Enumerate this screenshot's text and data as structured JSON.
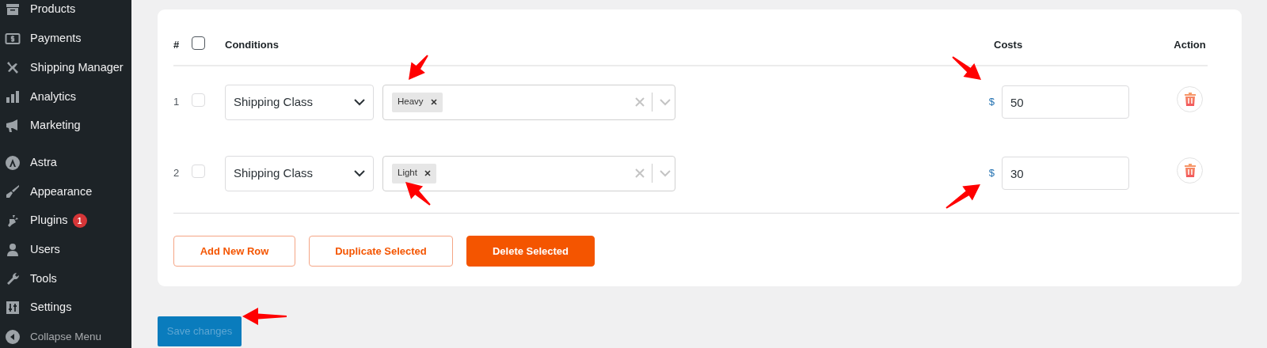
{
  "sidebar": {
    "groups": [
      [
        {
          "label": "Products"
        },
        {
          "label": "Payments"
        },
        {
          "label": "Shipping Manager"
        },
        {
          "label": "Analytics"
        },
        {
          "label": "Marketing"
        }
      ],
      [
        {
          "label": "Astra"
        },
        {
          "label": "Appearance"
        },
        {
          "label": "Plugins",
          "badge": "1"
        },
        {
          "label": "Users"
        },
        {
          "label": "Tools"
        },
        {
          "label": "Settings"
        }
      ]
    ],
    "collapse": {
      "label": "Collapse Menu"
    }
  },
  "table": {
    "columns": [
      {
        "label": "#",
        "kind": "number"
      },
      {
        "kind": "checkbox",
        "checked": false
      },
      {
        "label": "Conditions",
        "kind": "conditions"
      },
      {
        "label": "Costs",
        "kind": "costs"
      },
      {
        "label": "Action",
        "kind": "action"
      }
    ],
    "rows": [
      {
        "number": "1",
        "checked": false,
        "condition": "Shipping Class",
        "tags": [
          "Heavy"
        ],
        "currency": "$",
        "cost": "50"
      },
      {
        "number": "2",
        "checked": false,
        "condition": "Shipping Class",
        "tags": [
          "Light"
        ],
        "currency": "$",
        "cost": "30"
      }
    ]
  },
  "buttons": [
    {
      "label": "Add New Row",
      "kind": "outline"
    },
    {
      "label": "Duplicate Selected",
      "kind": "outline"
    },
    {
      "label": "Delete Selected",
      "kind": "filled"
    }
  ],
  "save_button": {
    "label": "Save changes",
    "disabled": true
  }
}
